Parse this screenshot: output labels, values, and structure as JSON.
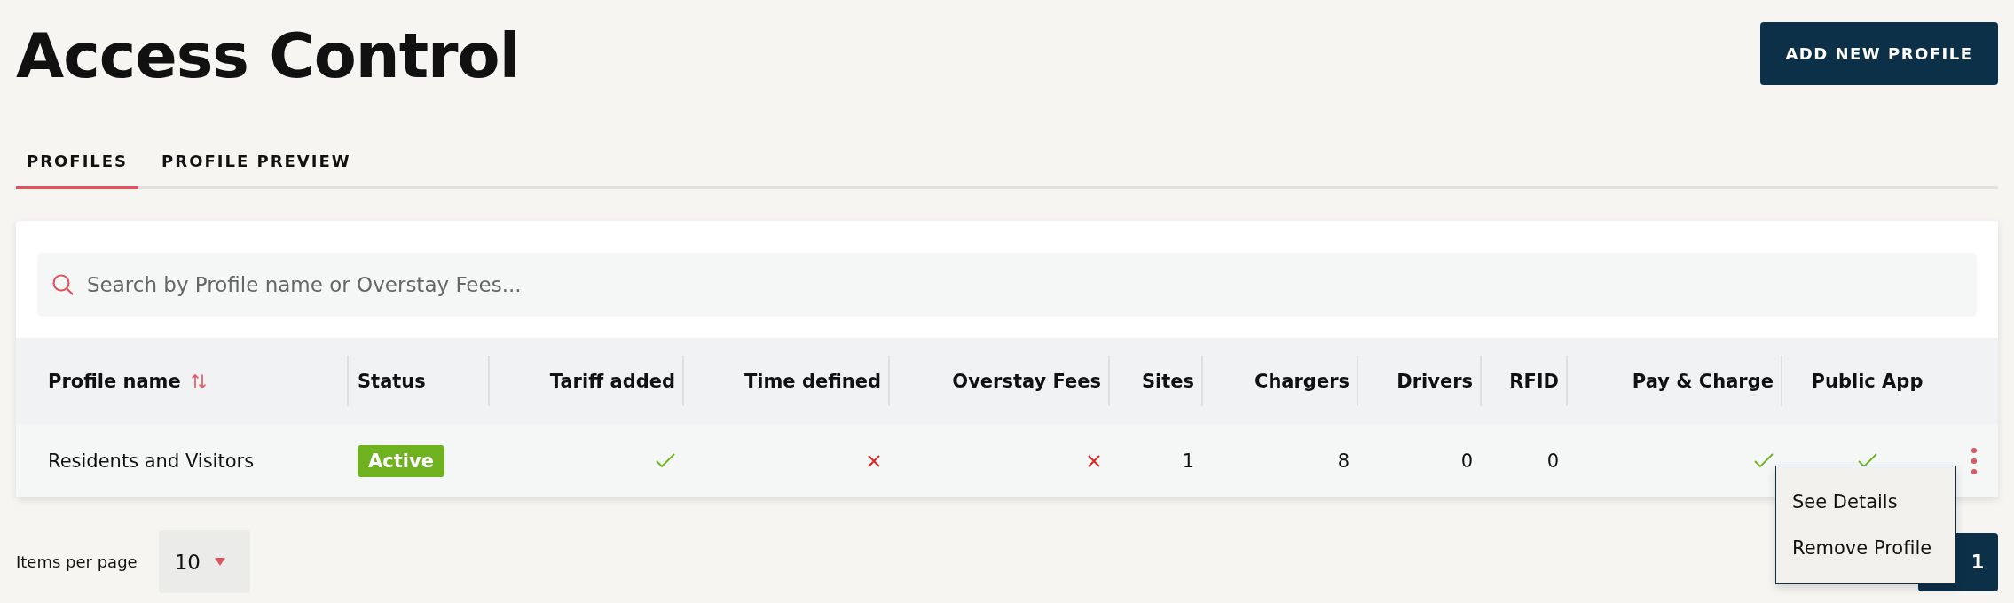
{
  "page": {
    "title": "Access Control",
    "add_button": "ADD NEW PROFILE"
  },
  "tabs": [
    {
      "label": "PROFILES",
      "selected": true
    },
    {
      "label": "PROFILE PREVIEW",
      "selected": false
    }
  ],
  "search": {
    "placeholder": "Search by Profile name or Overstay Fees..."
  },
  "table": {
    "columns": [
      "Profile name",
      "Status",
      "Tariff added",
      "Time defined",
      "Overstay Fees",
      "Sites",
      "Chargers",
      "Drivers",
      "RFID",
      "Pay & Charge",
      "Public App"
    ],
    "rows": [
      {
        "name": "Residents and Visitors",
        "status": "Active",
        "tariff_added": true,
        "time_defined": false,
        "overstay_fees": false,
        "sites": "1",
        "chargers": "8",
        "drivers": "0",
        "rfid": "0",
        "pay_and_charge": true,
        "public_app": true
      }
    ]
  },
  "row_menu": {
    "items": [
      "See Details",
      "Remove Profile"
    ]
  },
  "footer": {
    "items_per_page_label": "Items per page",
    "items_per_page": "10",
    "pages": [
      {
        "label": "1",
        "selected": true
      }
    ]
  }
}
